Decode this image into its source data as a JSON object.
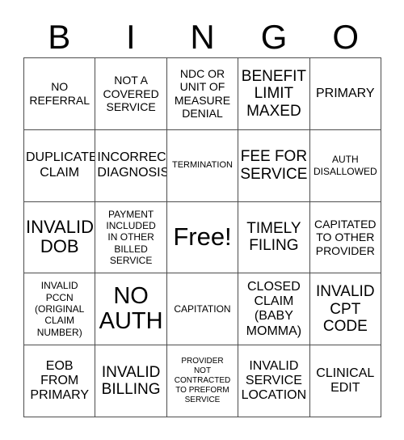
{
  "card": {
    "title": "BINGO",
    "header_letters": [
      "B",
      "I",
      "N",
      "G",
      "O"
    ],
    "border_color": "#4d4d4d",
    "background_color": "#ffffff",
    "text_color": "#000000",
    "rows": 5,
    "columns": 5,
    "free_space_index": 12,
    "cells": [
      {
        "text": "NO\nREFERRAL",
        "size": "fs-md"
      },
      {
        "text": "NOT A\nCOVERED\nSERVICE",
        "size": "fs-md"
      },
      {
        "text": "NDC OR\nUNIT OF\nMEASURE\nDENIAL",
        "size": "fs-md"
      },
      {
        "text": "BENEFIT\nLIMIT\nMAXED",
        "size": "fs-xl"
      },
      {
        "text": "PRIMARY",
        "size": "fs-lg"
      },
      {
        "text": "DUPLICATE\nCLAIM",
        "size": "fs-lg"
      },
      {
        "text": "INCORRECT\nDIAGNOSIS",
        "size": "fs-lg"
      },
      {
        "text": "TERMINATION",
        "size": "fs-sm"
      },
      {
        "text": "FEE FOR\nSERVICE",
        "size": "fs-xl"
      },
      {
        "text": "AUTH\nDISALLOWED",
        "size": "fs-smm"
      },
      {
        "text": "INVALID\nDOB",
        "size": "fs-xxl"
      },
      {
        "text": "PAYMENT\nINCLUDED\nIN OTHER\nBILLED\nSERVICE",
        "size": "fs-smm"
      },
      {
        "text": "Free!",
        "size": "fs-free"
      },
      {
        "text": "TIMELY\nFILING",
        "size": "fs-xl"
      },
      {
        "text": "CAPITATED\nTO OTHER\nPROVIDER",
        "size": "fs-md"
      },
      {
        "text": "INVALID\nPCCN\n(ORIGINAL\nCLAIM\nNUMBER)",
        "size": "fs-smm"
      },
      {
        "text": "NO\nAUTH",
        "size": "fs-huge"
      },
      {
        "text": "CAPITATION",
        "size": "fs-smm"
      },
      {
        "text": "CLOSED\nCLAIM\n(BABY\nMOMMA)",
        "size": "fs-lg"
      },
      {
        "text": "INVALID\nCPT\nCODE",
        "size": "fs-xl"
      },
      {
        "text": "EOB\nFROM\nPRIMARY",
        "size": "fs-lg"
      },
      {
        "text": "INVALID\nBILLING",
        "size": "fs-xl"
      },
      {
        "text": "PROVIDER\nNOT\nCONTRACTED\nTO PREFORM\nSERVICE",
        "size": "fs-xs"
      },
      {
        "text": "INVALID\nSERVICE\nLOCATION",
        "size": "fs-lg"
      },
      {
        "text": "CLINICAL\nEDIT",
        "size": "fs-lg"
      }
    ]
  }
}
